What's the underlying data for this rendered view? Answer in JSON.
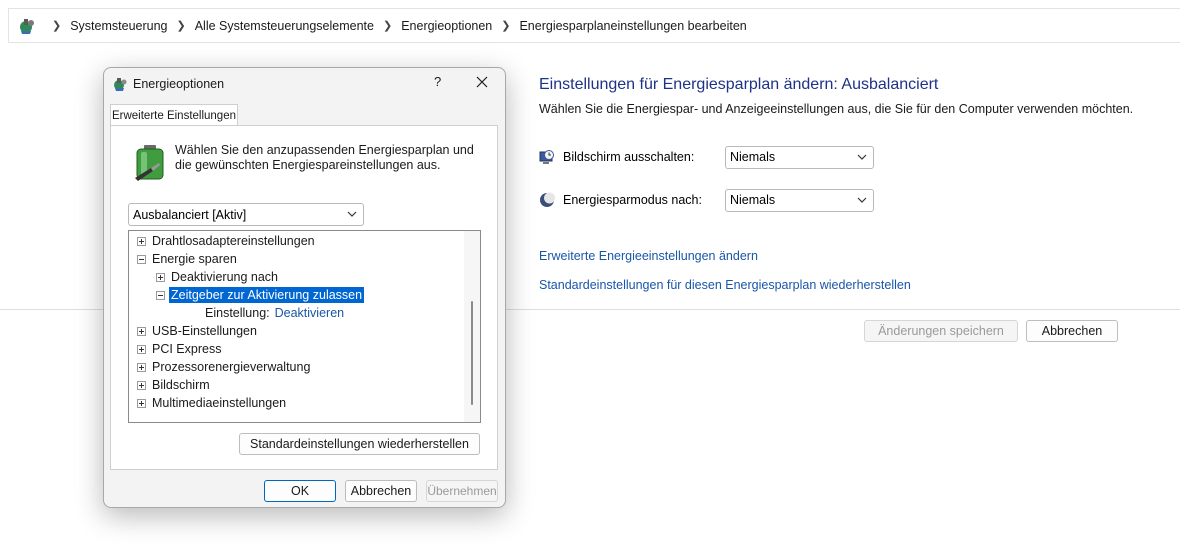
{
  "breadcrumb": [
    "Systemsteuerung",
    "Alle Systemsteuerungselemente",
    "Energieoptionen",
    "Energiesparplaneinstellungen bearbeiten"
  ],
  "main": {
    "title": "Einstellungen für Energiesparplan ändern: Ausbalanciert",
    "subtitle": "Wählen Sie die Energiespar- und Anzeigeeinstellungen aus, die Sie für den Computer verwenden möchten.",
    "display_off_label": "Bildschirm ausschalten:",
    "display_off_value": "Niemals",
    "sleep_label": "Energiesparmodus nach:",
    "sleep_value": "Niemals",
    "advanced_link": "Erweiterte Energieeinstellungen ändern",
    "restore_link": "Standardeinstellungen für diesen Energiesparplan wiederherstellen",
    "save_button": "Änderungen speichern",
    "cancel_button": "Abbrechen"
  },
  "dialog": {
    "title": "Energieoptionen",
    "help": "?",
    "tab": "Erweiterte Einstellungen",
    "intro": "Wählen Sie den anzupassenden Energiesparplan und die gewünschten Energiespareinstellungen aus.",
    "plan_value": "Ausbalanciert [Aktiv]",
    "tree": {
      "item1": "Drahtlosadaptereinstellungen",
      "item2": "Energie sparen",
      "item3": "Deaktivierung nach",
      "item4": "Zeitgeber zur Aktivierung zulassen",
      "setting_label": "Einstellung:",
      "setting_value": "Deaktivieren",
      "item5": "USB-Einstellungen",
      "item6": "PCI Express",
      "item7": "Prozessorenergieverwaltung",
      "item8": "Bildschirm",
      "item9": "Multimediaeinstellungen"
    },
    "restore_defaults": "Standardeinstellungen wiederherstellen",
    "ok": "OK",
    "cancel": "Abbrechen",
    "apply": "Übernehmen"
  },
  "colors": {
    "title_blue": "#1e3287",
    "link_blue": "#1a56a8",
    "selection": "#0066d2"
  },
  "icons": [
    "control-panel-icon",
    "battery-plan-icon",
    "monitor-clock-icon",
    "moon-icon",
    "close-icon",
    "chevron-down-icon"
  ]
}
